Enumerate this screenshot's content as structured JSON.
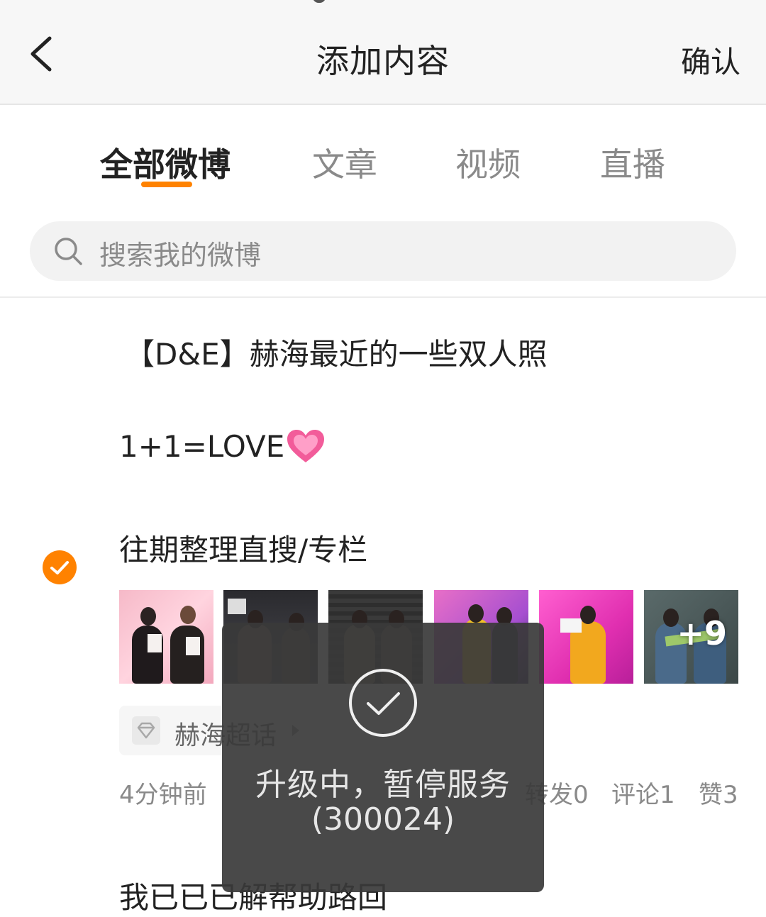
{
  "header": {
    "title": "添加内容",
    "confirm_label": "确认"
  },
  "tabs": [
    {
      "label": "全部微博",
      "active": true
    },
    {
      "label": "文章",
      "active": false
    },
    {
      "label": "视频",
      "active": false
    },
    {
      "label": "直播",
      "active": false
    }
  ],
  "search": {
    "placeholder": "搜索我的微博"
  },
  "post": {
    "title_line": "【D&E】赫海最近的一些双人照",
    "subtitle_line": "1+1=LOVE",
    "body_line": "往期整理直搜/专栏",
    "selected": true,
    "thumbnails": [
      {
        "name": "photo-1"
      },
      {
        "name": "photo-2"
      },
      {
        "name": "photo-3"
      },
      {
        "name": "photo-4"
      },
      {
        "name": "photo-5"
      },
      {
        "name": "photo-6"
      }
    ],
    "extra_images": "+9",
    "topic": "赫海超话",
    "time": "4分钟前",
    "reposts": "转发0",
    "comments": "评论1",
    "likes": "赞3"
  },
  "next_post_partial": "我已已已解帮助路回",
  "toast": {
    "message": "升级中，暂停服务",
    "code": "(300024)"
  },
  "colors": {
    "accent": "#ff8200",
    "header_bg": "#f7f7f7",
    "toast_bg": "#3a3a3a"
  }
}
